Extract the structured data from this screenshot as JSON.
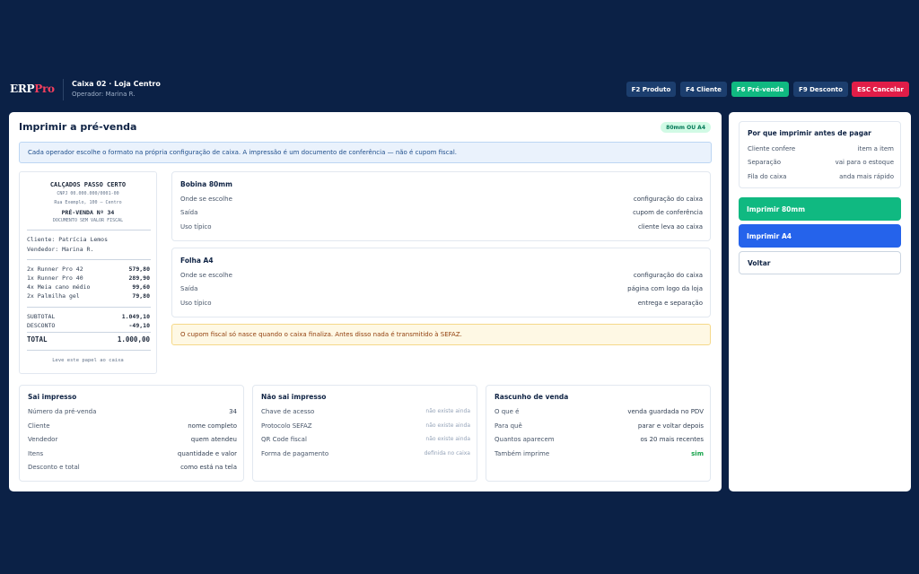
{
  "header": {
    "logo_main": "ERP",
    "logo_accent": "Pro",
    "register": "Caixa 02 · Loja Centro",
    "operator": "Operador: Marina R.",
    "shortcuts": [
      "F2 Produto",
      "F4 Cliente",
      "F6 Pré-venda",
      "F9 Desconto",
      "ESC Cancelar"
    ]
  },
  "dialog": {
    "title": "Imprimir a pré-venda",
    "badge": "80mm OU A4",
    "info": "Cada operador escolhe o formato na própria configuração de caixa. A impressão é um documento de conferência — não é cupom fiscal.",
    "warning": "O cupom fiscal só nasce quando o caixa finaliza. Antes disso nada é transmitido à SEFAZ."
  },
  "receipt": {
    "store": "CALÇADOS PASSO CERTO",
    "cnpj": "CNPJ 00.000.000/0001-00",
    "address": "Rua Exemplo, 100 — Centro",
    "number": "PRÉ-VENDA Nº 34",
    "doc_note": "DOCUMENTO SEM VALOR FISCAL",
    "customer": "Cliente: Patrícia Lemos",
    "seller": "Vendedor: Marina R.",
    "items": [
      {
        "desc": "2x Runner Pro 42",
        "value": "579,80"
      },
      {
        "desc": "1x Runner Pro 40",
        "value": "289,90"
      },
      {
        "desc": "4x Meia cano médio",
        "value": "99,60"
      },
      {
        "desc": "2x Palmilha gel",
        "value": "79,80"
      }
    ],
    "subtotal_label": "SUBTOTAL",
    "subtotal": "1.049,10",
    "discount_label": "DESCONTO",
    "discount": "-49,10",
    "total_label": "TOTAL",
    "total": "1.000,00",
    "footer": "Leve este papel ao caixa"
  },
  "formats": [
    {
      "title": "Bobina 80mm",
      "rows": [
        {
          "label": "Onde se escolhe",
          "value": "configuração do caixa"
        },
        {
          "label": "Saída",
          "value": "cupom de conferência"
        },
        {
          "label": "Uso típico",
          "value": "cliente leva ao caixa"
        }
      ]
    },
    {
      "title": "Folha A4",
      "rows": [
        {
          "label": "Onde se escolhe",
          "value": "configuração do caixa"
        },
        {
          "label": "Saída",
          "value": "página com logo da loja"
        },
        {
          "label": "Uso típico",
          "value": "entrega e separação"
        }
      ]
    }
  ],
  "bottom_cards": [
    {
      "title": "Sai impresso",
      "rows": [
        {
          "label": "Número da pré-venda",
          "value": "34"
        },
        {
          "label": "Cliente",
          "value": "nome completo"
        },
        {
          "label": "Vendedor",
          "value": "quem atendeu"
        },
        {
          "label": "Itens",
          "value": "quantidade e valor"
        },
        {
          "label": "Desconto e total",
          "value": "como está na tela"
        }
      ]
    },
    {
      "title": "Não sai impresso",
      "rows": [
        {
          "label": "Chave de acesso",
          "value": "não existe ainda"
        },
        {
          "label": "Protocolo SEFAZ",
          "value": "não existe ainda"
        },
        {
          "label": "QR Code fiscal",
          "value": "não existe ainda"
        },
        {
          "label": "Forma de pagamento",
          "value": "definida no caixa"
        }
      ]
    },
    {
      "title": "Rascunho de venda",
      "rows": [
        {
          "label": "O que é",
          "value": "venda guardada no PDV"
        },
        {
          "label": "Para quê",
          "value": "parar e voltar depois"
        },
        {
          "label": "Quantos aparecem",
          "value": "os 20 mais recentes"
        },
        {
          "label": "Também imprime",
          "value": "sim"
        }
      ]
    }
  ],
  "sidebar": {
    "why_title": "Por que imprimir antes de pagar",
    "why_rows": [
      {
        "label": "Cliente confere",
        "value": "item a item"
      },
      {
        "label": "Separação",
        "value": "vai para o estoque"
      },
      {
        "label": "Fila do caixa",
        "value": "anda mais rápido"
      }
    ],
    "btn_80": "Imprimir 80mm",
    "btn_a4": "Imprimir A4",
    "btn_back": "Voltar"
  },
  "colors": {
    "background": "#0b2146",
    "accent_green": "#10b981",
    "accent_blue": "#2563eb",
    "danger": "#e11d48"
  }
}
